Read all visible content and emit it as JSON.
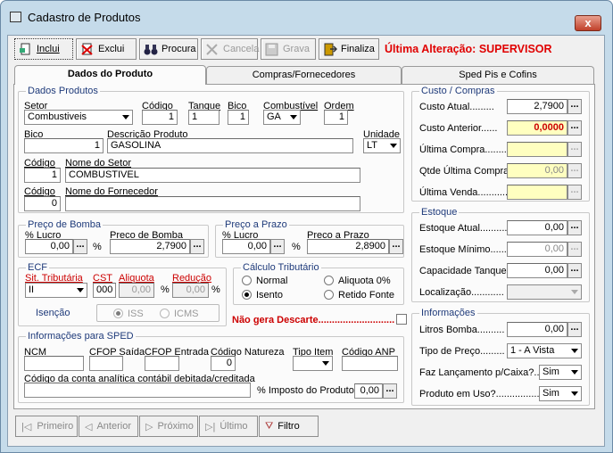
{
  "window": {
    "title": "Cadastro de Produtos",
    "close": "x"
  },
  "toolbar": {
    "incluir": "Inclui",
    "excluir": "Exclui",
    "procurar": "Procura",
    "cancelar": "Cancela",
    "gravar": "Grava",
    "finalizar": "Finaliza",
    "last_change": "Última Alteração: SUPERVISOR"
  },
  "tabs": [
    "Dados do Produto",
    "Compras/Fornecedores",
    "Sped Pis e Cofins"
  ],
  "dados": {
    "title": "Dados Produtos",
    "setor_label": "Setor",
    "setor_value": "Combustiveis",
    "codigo_label": "Código",
    "codigo_value": "1",
    "tanque_label": "Tanque",
    "tanque_value": "1",
    "bico_label": "Bico",
    "bico_value": "1",
    "combustivel_label": "Combustível",
    "combustivel_value": "GA",
    "ordem_label": "Ordem",
    "ordem_value": "1",
    "bico2_label": "Bico",
    "bico2_value": "1",
    "descricao_label": "Descrição Produto",
    "descricao_value": "GASOLINA",
    "unidade_label": "Unidade",
    "unidade_value": "LT",
    "codsetor_label": "Código",
    "codsetor_value": "1",
    "nomesetor_label": "Nome do Setor",
    "nomesetor_value": "COMBUSTIVEL",
    "codforn_label": "Código",
    "codforn_value": "0",
    "nomeforn_label": "Nome do Fornecedor",
    "nomeforn_value": ""
  },
  "preco_bomba": {
    "title": "Preço de Bomba",
    "lucro_label": "% Lucro",
    "lucro_value": "0,00",
    "pct": "%",
    "preco_label": "Preco de Bomba",
    "preco_value": "2,7900"
  },
  "preco_prazo": {
    "title": "Preço a Prazo",
    "lucro_label": "% Lucro",
    "lucro_value": "0,00",
    "pct": "%",
    "preco_label": "Preco a Prazo",
    "preco_value": "2,8900"
  },
  "ecf": {
    "title": "ECF",
    "sit_label": "Sit. Tributária",
    "sit_value": "II",
    "cst_label": "CST",
    "cst_value": "000",
    "aliq_label": "Aliquota",
    "aliq_value": "0,00",
    "pct1": "%",
    "red_label": "Redução",
    "red_value": "0,00",
    "pct2": "%",
    "isencao_label": "Isenção",
    "iss_label": "ISS",
    "icms_label": "ICMS"
  },
  "calculo": {
    "title": "Cálculo Tributário",
    "normal": "Normal",
    "aliq": "Aliquota 0%",
    "isento": "Isento",
    "retido": "Retido Fonte"
  },
  "descarte": {
    "label": "Não gera Descarte............................"
  },
  "sped": {
    "title": "Informações para SPED",
    "ncm_label": "NCM",
    "cfop_saida_label": "CFOP Saída",
    "cfop_entrada_label": "CFOP Entrada",
    "cod_natureza_label": "Código Natureza",
    "cod_natureza_value": "0",
    "tipo_item_label": "Tipo Item",
    "cod_anp_label": "Código ANP",
    "conta_label": "Código da conta analítica contábil debitada/creditada",
    "imposto_label": "% Imposto do Produto",
    "imposto_value": "0,00"
  },
  "custo": {
    "title": "Custo / Compras",
    "atual_label": "Custo Atual.........",
    "atual_value": "2,7900",
    "anterior_label": "Custo Anterior......",
    "anterior_value": "0,0000",
    "ult_compra_label": "Última Compra.........",
    "ult_compra_value": "",
    "qtde_label": "Qtde Última Compra..",
    "qtde_value": "0,00",
    "ult_venda_label": "Última Venda...........",
    "ult_venda_value": ""
  },
  "estoque": {
    "title": "Estoque",
    "atual_label": "Estoque Atual..........",
    "atual_value": "0,00",
    "minimo_label": "Estoque Mínimo........",
    "minimo_value": "0,00",
    "capacidade_label": "Capacidade Tanque.",
    "capacidade_value": "0,00",
    "localizacao_label": "Localização............",
    "localizacao_value": ""
  },
  "info": {
    "title": "Informações",
    "litros_label": "Litros Bomba..........",
    "litros_value": "0,00",
    "tipo_preco_label": "Tipo de Preço.........",
    "tipo_preco_value": "1 - A Vista",
    "faz_lanc_label": "Faz Lançamento p/Caixa?...",
    "faz_lanc_value": "Sim",
    "em_uso_label": "Produto em Uso?................",
    "em_uso_value": "Sim"
  },
  "nav": {
    "primeiro": "Primeiro",
    "anterior": "Anterior",
    "proximo": "Próximo",
    "ultimo": "Último",
    "filtro": "Filtro"
  },
  "colors": {
    "accent_red": "#e00000",
    "group_title": "#1e3a7a",
    "highlight_yellow": "#ffffc0"
  }
}
